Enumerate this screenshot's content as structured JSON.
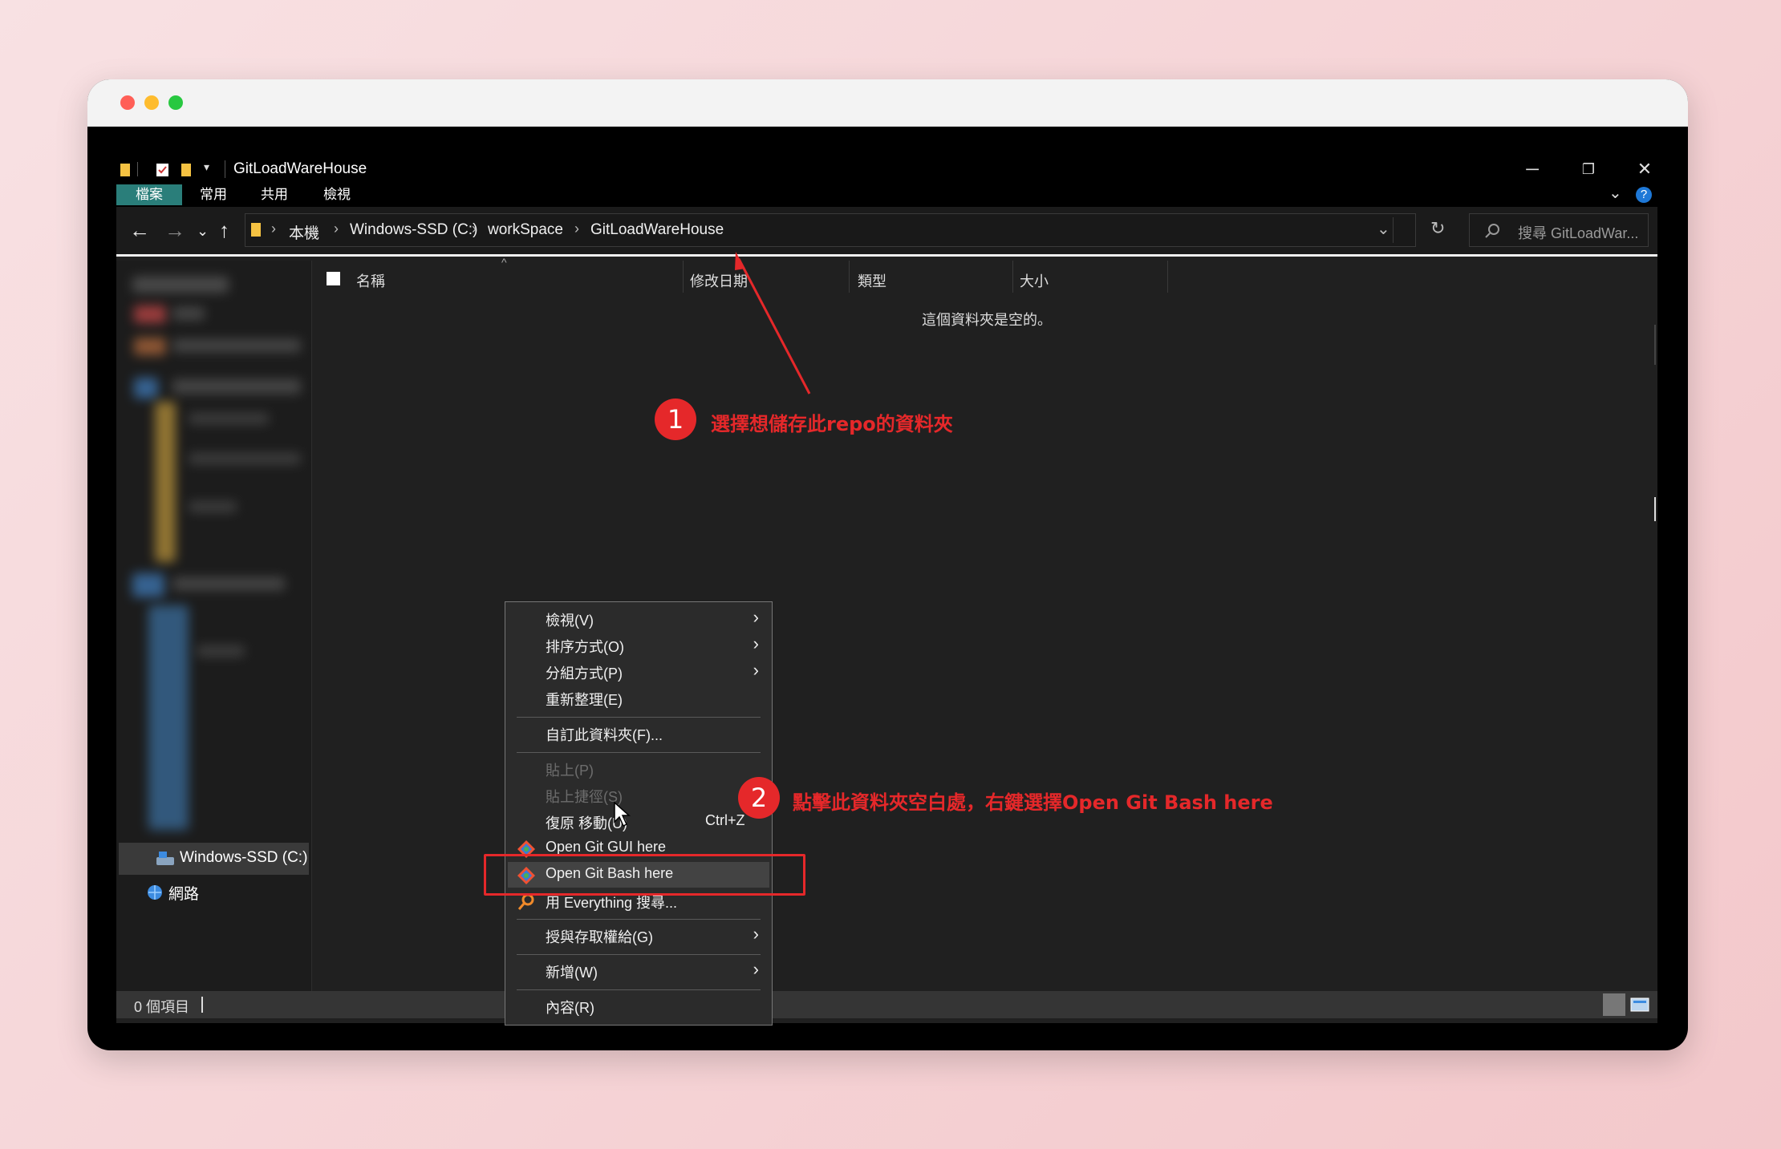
{
  "window": {
    "title": "GitLoadWareHouse"
  },
  "ribbon": {
    "tabs": [
      "檔案",
      "常用",
      "共用",
      "檢視"
    ]
  },
  "address": {
    "crumbs": [
      "本機",
      "Windows-SSD (C:)",
      "workSpace",
      "GitLoadWareHouse"
    ]
  },
  "search": {
    "placeholder": "搜尋 GitLoadWar..."
  },
  "columns": [
    "名稱",
    "修改日期",
    "類型",
    "大小"
  ],
  "content": {
    "empty_message": "這個資料夾是空的。"
  },
  "nav": {
    "drive_label": "Windows-SSD (C:)",
    "network_label": "網路"
  },
  "status": {
    "item_count": "0 個項目"
  },
  "context_menu": {
    "view": "檢視(V)",
    "sort": "排序方式(O)",
    "group": "分組方式(P)",
    "refresh": "重新整理(E)",
    "customize": "自訂此資料夾(F)...",
    "paste": "貼上(P)",
    "paste_shortcut": "貼上捷徑(S)",
    "undo": "復原 移動(U)",
    "undo_shortcut": "Ctrl+Z",
    "git_gui": "Open Git GUI here",
    "git_bash": "Open Git Bash here",
    "everything": "用 Everything 搜尋...",
    "grant_access": "授與存取權給(G)",
    "new": "新增(W)",
    "properties": "內容(R)"
  },
  "annotations": {
    "step1_number": "1",
    "step1_text": "選擇想儲存此repo的資料夾",
    "step2_number": "2",
    "step2_text": "點擊此資料夾空白處，右鍵選擇Open Git Bash here",
    "color": "#e5282a"
  },
  "colors": {
    "accent_tab": "#2a7e7a",
    "explorer_bg": "#202020",
    "page_bg": "#f3c8cb"
  },
  "icons": {
    "back": "back-arrow-icon",
    "forward": "forward-arrow-icon",
    "up": "up-arrow-icon",
    "refresh": "refresh-icon",
    "search": "search-icon",
    "help": "help-icon"
  }
}
